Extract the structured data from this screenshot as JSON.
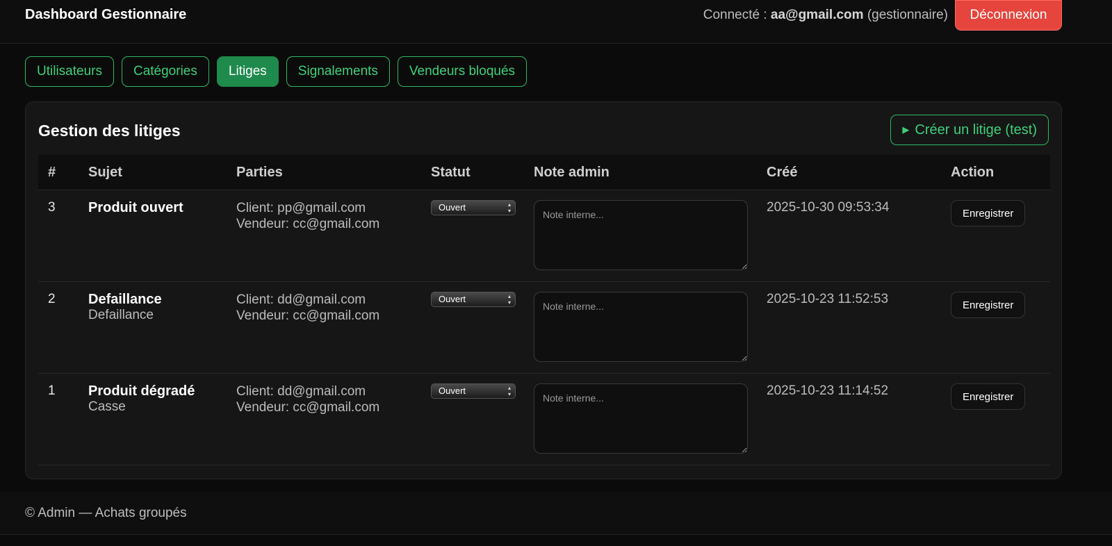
{
  "header": {
    "title": "Dashboard Gestionnaire",
    "connected_prefix": "Connecté :",
    "user_email": "aa@gmail.com",
    "role": "(gestionnaire)",
    "logout_label": "Déconnexion"
  },
  "tabs": [
    {
      "label": "Utilisateurs",
      "active": false
    },
    {
      "label": "Catégories",
      "active": false
    },
    {
      "label": "Litiges",
      "active": true
    },
    {
      "label": "Signalements",
      "active": false
    },
    {
      "label": "Vendeurs bloqués",
      "active": false
    }
  ],
  "panel": {
    "title": "Gestion des litiges",
    "create_icon": "play-icon",
    "create_label": "Créer un litige (test)"
  },
  "table": {
    "headers": [
      "#",
      "Sujet",
      "Parties",
      "Statut",
      "Note admin",
      "Créé",
      "Action"
    ],
    "note_placeholder": "Note interne...",
    "save_label": "Enregistrer",
    "rows": [
      {
        "id": "3",
        "subject": "Produit ouvert",
        "detail": "",
        "client": "Client: pp@gmail.com",
        "vendor": "Vendeur: cc@gmail.com",
        "status": "Ouvert",
        "created": "2025-10-30 09:53:34"
      },
      {
        "id": "2",
        "subject": "Defaillance",
        "detail": "Defaillance",
        "client": "Client: dd@gmail.com",
        "vendor": "Vendeur: cc@gmail.com",
        "status": "Ouvert",
        "created": "2025-10-23 11:52:53"
      },
      {
        "id": "1",
        "subject": "Produit dégradé",
        "detail": "Casse",
        "client": "Client: dd@gmail.com",
        "vendor": "Vendeur: cc@gmail.com",
        "status": "Ouvert",
        "created": "2025-10-23 11:14:52"
      }
    ]
  },
  "footer": {
    "text": "© Admin — Achats groupés"
  },
  "colors": {
    "accent": "#3fd07a",
    "active_tab": "#1e8a4c",
    "danger": "#e5453d"
  }
}
